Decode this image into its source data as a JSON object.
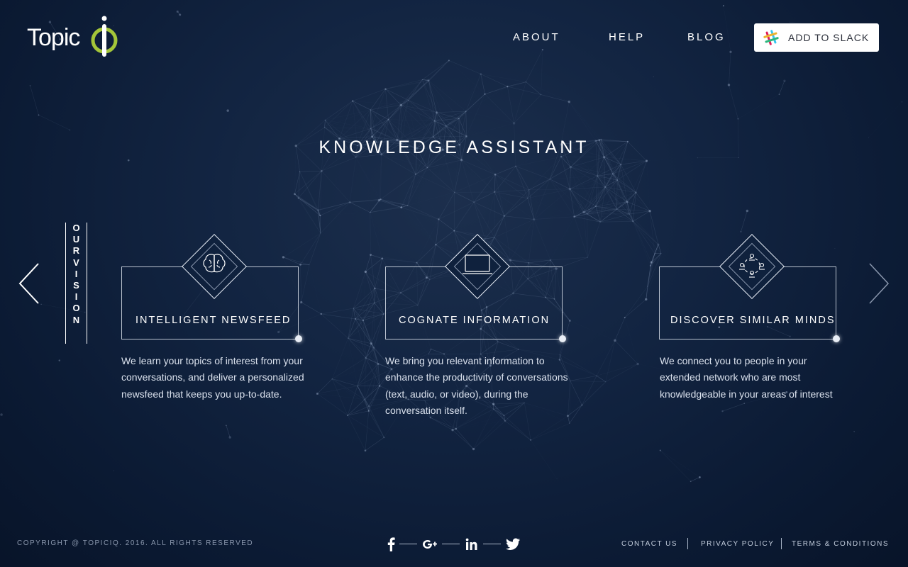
{
  "header": {
    "logo_text": "Topic",
    "nav": [
      {
        "label": "ABOUT"
      },
      {
        "label": "HELP"
      },
      {
        "label": "BLOG"
      }
    ],
    "slack_button": {
      "label": "ADD TO SLACK",
      "icon": "slack-icon"
    }
  },
  "hero": {
    "title": "KNOWLEDGE ASSISTANT",
    "vertical_label": [
      "O",
      "U",
      "R",
      " ",
      "V",
      "I",
      "S",
      "I",
      "O",
      "N"
    ]
  },
  "features": [
    {
      "icon": "brain-icon",
      "title": "INTELLIGENT NEWSFEED",
      "description": "We learn your topics of interest from your conversations, and deliver a personalized newsfeed that keeps you up-to-date."
    },
    {
      "icon": "laptop-icon",
      "title": "COGNATE INFORMATION",
      "description": "We bring you relevant information to enhance the productivity of conversations (text, audio, or video), during the conversation itself."
    },
    {
      "icon": "people-network-icon",
      "title": "DISCOVER SIMILAR MINDS",
      "description": "We connect you to people in your extended network who are most knowledgeable in your areas of interest"
    }
  ],
  "footer": {
    "copyright": "COPYRIGHT @ TOPICIQ. 2016. ALL RIGHTS RESERVED",
    "social": [
      "facebook-icon",
      "google-plus-icon",
      "linkedin-icon",
      "twitter-icon"
    ],
    "links": [
      {
        "label": "CONTACT US"
      },
      {
        "label": "PRIVACY POLICY"
      },
      {
        "label": "TERMS & CONDITIONS"
      }
    ]
  },
  "colors": {
    "background": "#0f213d",
    "accent_logo": "#a4c639",
    "text": "#ffffff"
  }
}
